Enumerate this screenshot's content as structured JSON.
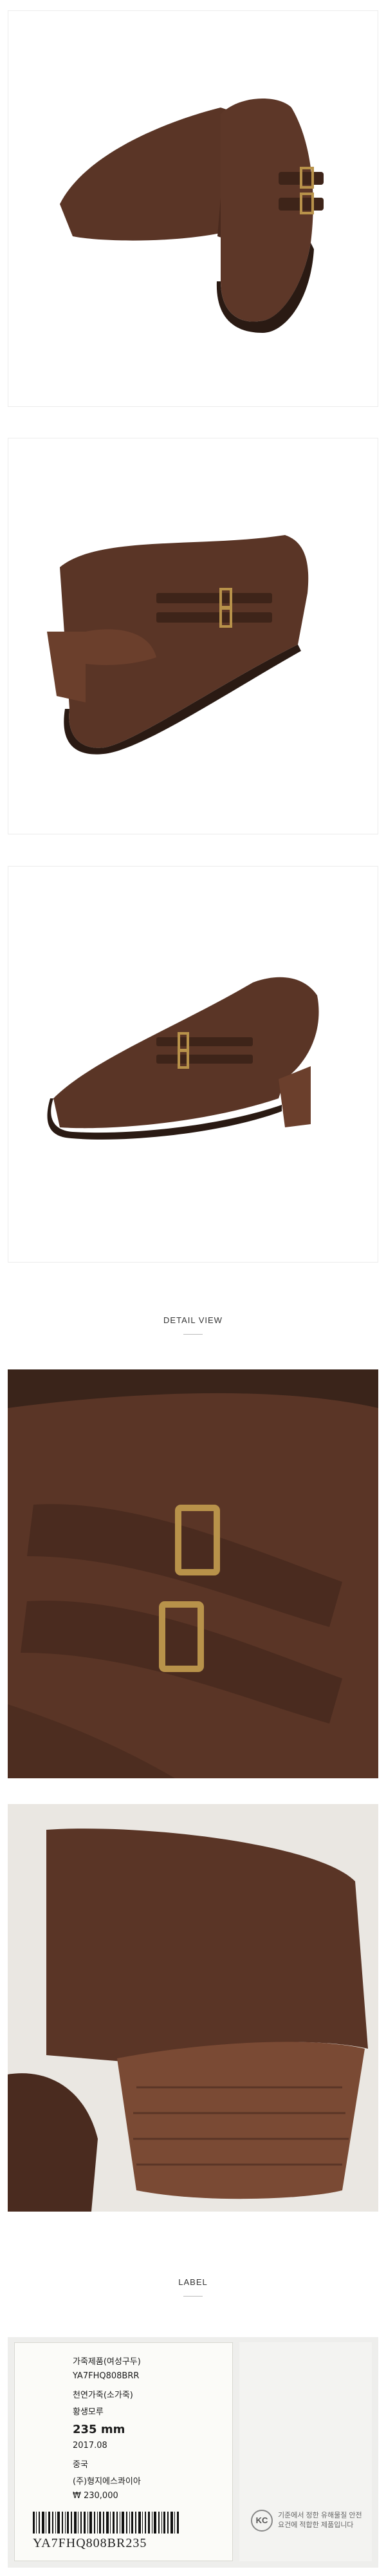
{
  "sections": {
    "detail_view": "DETAIL VIEW",
    "label": "LABEL"
  },
  "label_tag": {
    "product_type": "가죽제품(여성구두)",
    "model": "YA7FHQ808BRR",
    "material": "천연가죽(소가죽)",
    "color": "황생모루",
    "size": "235 mm",
    "date": "2017.08",
    "origin": "중국",
    "importer": "(주)형지에스콰이아",
    "price": "₩ 230,000",
    "barcode_number": "YA7FHQ808BR235",
    "kc_mark": "KC",
    "kc_notice": "기준에서 정한 유해물질 안전요건에 적합한 제품입니다"
  },
  "colors": {
    "leather": "#5a3526",
    "leather_dark": "#3e2419",
    "heel": "#6b3f2c",
    "buckle": "#b8924a"
  }
}
